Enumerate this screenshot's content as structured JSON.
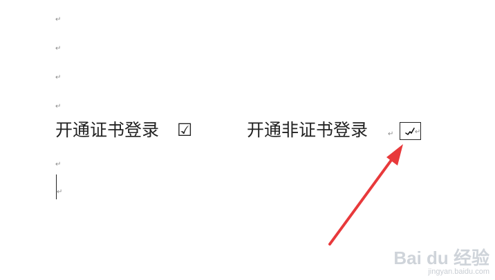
{
  "document": {
    "paragraph_mark": "↵",
    "option_certificate_label": "开通证书登录",
    "option_certificate_checkbox": "☑",
    "option_noncertificate_label": "开通非证书登录"
  },
  "annotation": {
    "arrow_color": "#e8393b"
  },
  "watermark": {
    "brand": "Bai du 经验",
    "url": "jingyan.baidu.com"
  }
}
